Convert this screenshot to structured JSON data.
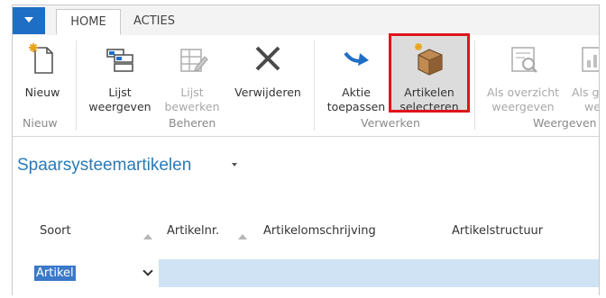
{
  "tabs": {
    "home": "HOME",
    "acties": "ACTIES"
  },
  "ribbon": {
    "nieuw": "Nieuw",
    "lijst_weergeven": [
      "Lijst",
      "weergeven"
    ],
    "lijst_bewerken": [
      "Lijst",
      "bewerken"
    ],
    "verwijderen": "Verwijderen",
    "aktie_toepassen": [
      "Aktie",
      "toepassen"
    ],
    "artikelen_selecteren": [
      "Artikelen",
      "selecteren"
    ],
    "als_overzicht_weergeven": [
      "Als overzicht",
      "weergeven"
    ],
    "als_grafiek_weergeven_partial": [
      "Als g",
      "wee"
    ],
    "groups": {
      "nieuw": "Nieuw",
      "beheren": "Beheren",
      "verwerken": "Verwerken",
      "weergeven_partial": "Weergeven"
    }
  },
  "page": {
    "title": "Spaarsysteemartikelen"
  },
  "grid": {
    "headers": [
      "Soort",
      "Artikelnr.",
      "Artikelomschrijving",
      "Artikelstructuur"
    ],
    "rows": [
      {
        "soort": "Artikel"
      }
    ]
  },
  "colors": {
    "accent": "#1f6ec6",
    "title": "#2a7ab8",
    "highlight_border": "#e0141b",
    "row_selected": "#cfe3f5"
  },
  "icons": {
    "nieuw": "new-document-icon",
    "lijst_weergeven": "list-view-icon",
    "lijst_bewerken": "list-edit-icon",
    "verwijderen": "delete-x-icon",
    "aktie_toepassen": "apply-arrow-icon",
    "artikelen_selecteren": "box-select-icon",
    "als_overzicht_weergeven": "report-view-icon",
    "als_grafiek_weergeven": "chart-view-icon"
  }
}
